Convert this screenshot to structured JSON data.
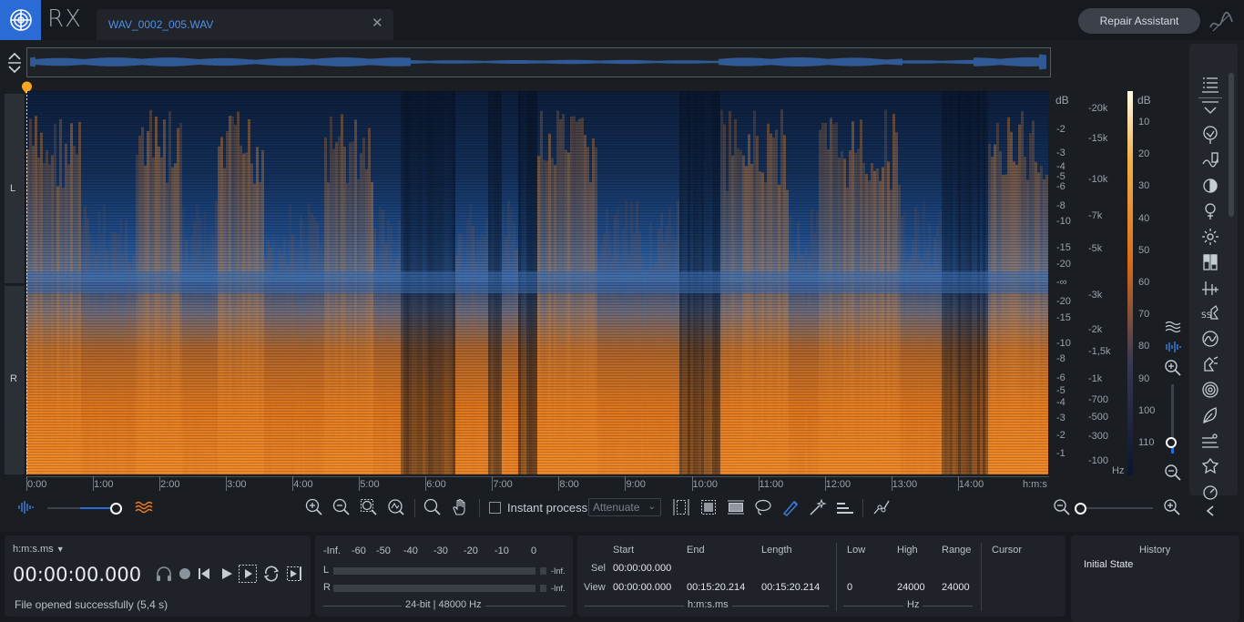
{
  "app": {
    "name": "RX",
    "colors": {
      "accent": "#2a6bd6",
      "waveform": "#3c7fe0",
      "spectro_hot": "#f07a22",
      "spectro_cool": "#1b3660"
    }
  },
  "tab": {
    "label": "WAV_0002_005.WAV",
    "close_icon": "close-icon"
  },
  "header": {
    "repair_assistant": "Repair Assistant"
  },
  "channels": {
    "left": "L",
    "right": "R"
  },
  "db_scale": {
    "unit": "dB",
    "left_ticks": [
      "-2",
      "-3",
      "-4",
      "-5",
      "-6",
      "-8",
      "-10",
      "-15",
      "-20",
      "-∞"
    ],
    "right_ticks": [
      "-20",
      "-15",
      "-10",
      "-8",
      "-6",
      "-5",
      "-4",
      "-3",
      "-2",
      "-1"
    ]
  },
  "hz_scale": {
    "ticks": [
      "-20k",
      "-15k",
      "-10k",
      "-7k",
      "-5k",
      "-3k",
      "-2k",
      "-1,5k",
      "-1k",
      "-700",
      "-500",
      "-300",
      "-100"
    ],
    "unit": "Hz"
  },
  "color_scale": {
    "unit": "dB",
    "ticks": [
      "10",
      "20",
      "30",
      "40",
      "50",
      "60",
      "70",
      "80",
      "90",
      "100",
      "110"
    ]
  },
  "time_axis": {
    "ticks": [
      "0:00",
      "1:00",
      "2:00",
      "3:00",
      "4:00",
      "5:00",
      "6:00",
      "7:00",
      "8:00",
      "9:00",
      "10:00",
      "11:00",
      "12:00",
      "13:00",
      "14:00"
    ],
    "unit": "h:m:s"
  },
  "toolbar": {
    "instant_process": "Instant process",
    "attenuate": "Attenuate",
    "frequency_zoom_level": 0.88
  },
  "transport": {
    "format": "h:m:s.ms",
    "time": "00:00:00.000",
    "status": "File opened successfully (5,4 s)"
  },
  "meters": {
    "ticks": [
      "-Inf.",
      "-60",
      "-50",
      "-40",
      "-30",
      "-20",
      "-10",
      "0"
    ],
    "l_label": "L",
    "r_label": "R",
    "l_value": "-Inf.",
    "r_value": "-Inf.",
    "format": "24-bit | 48000 Hz"
  },
  "selection": {
    "headers": [
      "Start",
      "End",
      "Length"
    ],
    "sel_label": "Sel",
    "view_label": "View",
    "sel_start": "00:00:00.000",
    "view_start": "00:00:00.000",
    "view_end": "00:15:20.214",
    "view_length": "00:15:20.214",
    "unit": "h:m:s.ms"
  },
  "frequency": {
    "headers": [
      "Low",
      "High",
      "Range"
    ],
    "low": "0",
    "high": "24000",
    "range": "24000",
    "unit": "Hz"
  },
  "cursor": {
    "label": "Cursor"
  },
  "history": {
    "title": "History",
    "items": [
      "Initial State"
    ]
  }
}
